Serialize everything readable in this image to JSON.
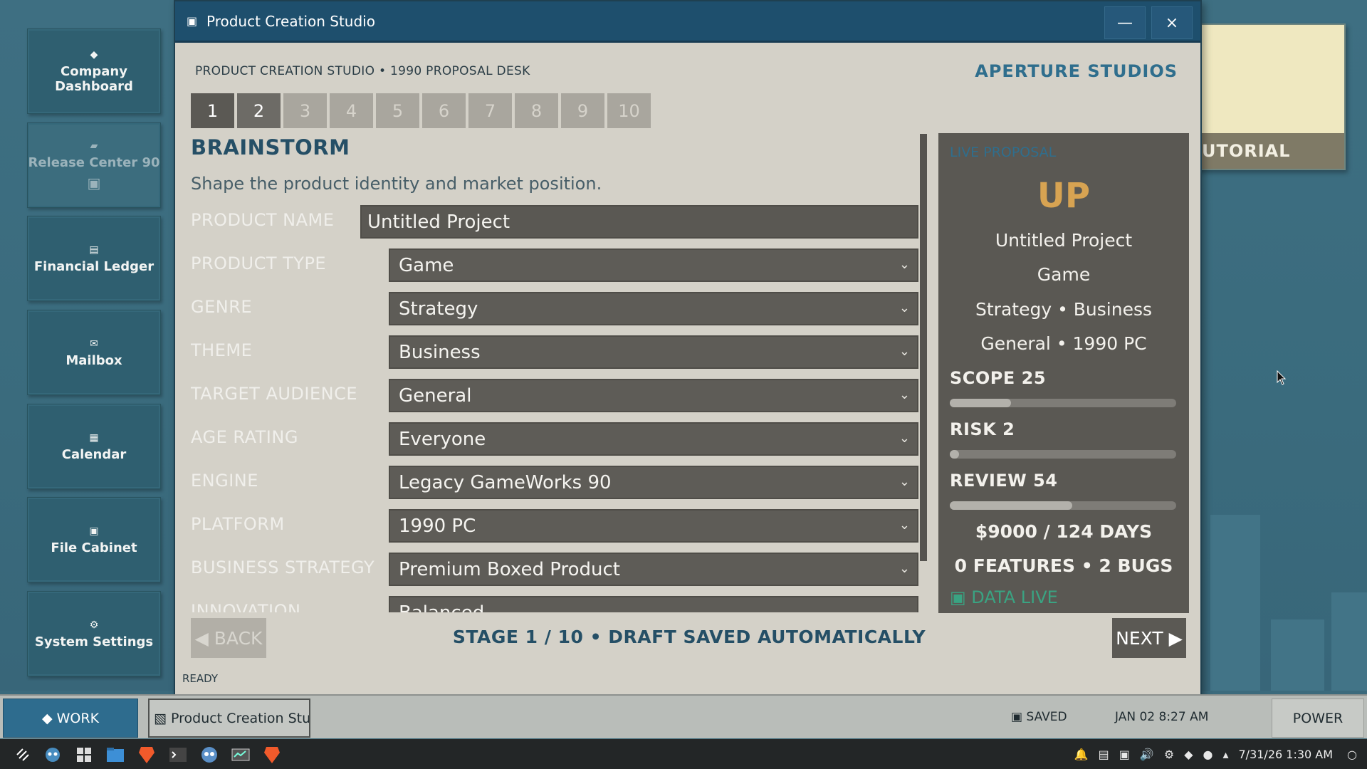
{
  "sidebar": {
    "items": [
      {
        "icon": "◆",
        "label": "Company Dashboard"
      },
      {
        "icon": "▰",
        "label": "Release Center 90",
        "extra": "▣"
      },
      {
        "icon": "▤",
        "label": "Financial Ledger"
      },
      {
        "icon": "✉",
        "label": "Mailbox"
      },
      {
        "icon": "▦",
        "label": "Calendar"
      },
      {
        "icon": "▣",
        "label": "File Cabinet"
      },
      {
        "icon": "⚙",
        "label": "System Settings"
      }
    ]
  },
  "tutorial": {
    "label": "UTORIAL"
  },
  "window": {
    "title_icon": "▣",
    "title": "Product Creation Studio",
    "minimize": "—",
    "close": "×",
    "breadcrumb": "PRODUCT CREATION STUDIO  •  1990 PROPOSAL DESK",
    "company": "APERTURE STUDIOS",
    "steps": [
      "1",
      "2",
      "3",
      "4",
      "5",
      "6",
      "7",
      "8",
      "9",
      "10"
    ],
    "section_title": "BRAINSTORM",
    "section_subtitle": "Shape the product identity and market position.",
    "form": {
      "product_name": {
        "label": "PRODUCT NAME",
        "value": "Untitled Project"
      },
      "product_type": {
        "label": "PRODUCT TYPE",
        "value": "Game"
      },
      "genre": {
        "label": "GENRE",
        "value": "Strategy"
      },
      "theme": {
        "label": "THEME",
        "value": "Business"
      },
      "target_audience": {
        "label": "TARGET AUDIENCE",
        "value": "General"
      },
      "age_rating": {
        "label": "AGE RATING",
        "value": "Everyone"
      },
      "engine": {
        "label": "ENGINE",
        "value": "Legacy GameWorks 90"
      },
      "platform": {
        "label": "PLATFORM",
        "value": "1990 PC"
      },
      "business_strategy": {
        "label": "BUSINESS STRATEGY",
        "value": "Premium Boxed Product"
      },
      "innovation": {
        "label": "INNOVATION",
        "value": "Balanced"
      }
    },
    "live": {
      "header": "LIVE PROPOSAL",
      "abbr": "UP",
      "name": "Untitled Project",
      "type": "Game",
      "genre_theme": "Strategy • Business",
      "audience_platform": "General • 1990 PC",
      "scope_label": "SCOPE  25",
      "scope_value": 25,
      "risk_label": "RISK  2",
      "risk_value": 2,
      "review_label": "REVIEW  54",
      "review_value": 54,
      "budget": "$9000 / 124 DAYS",
      "features_bugs": "0 FEATURES • 2 BUGS",
      "data_live": "▣ DATA LIVE"
    },
    "back": "◀ BACK",
    "next": "NEXT ▶",
    "stage": "STAGE 1 / 10  •  DRAFT SAVED AUTOMATICALLY",
    "status": "READY"
  },
  "gamebar": {
    "work": "◆  WORK",
    "task": "▧ Product Creation Studio",
    "saved": "▣ SAVED",
    "clock": "JAN 02  8:27 AM",
    "power": "POWER"
  },
  "os": {
    "clock": "7/31/26  1:30 AM",
    "apps": [
      "launcher-icon",
      "godot-icon",
      "apps-grid-icon",
      "file-manager-icon",
      "brave-icon",
      "terminal-icon",
      "godot-editor-icon",
      "system-monitor-icon",
      "brave-icon-2"
    ]
  },
  "colors": {
    "desktop": "#3b6a7c",
    "window_bg": "#d4d1c8",
    "titlebar": "#1e4f6d",
    "accent": "#2f6e8d",
    "abbr_gold": "#d7a352",
    "data_live_green": "#3aa382"
  }
}
